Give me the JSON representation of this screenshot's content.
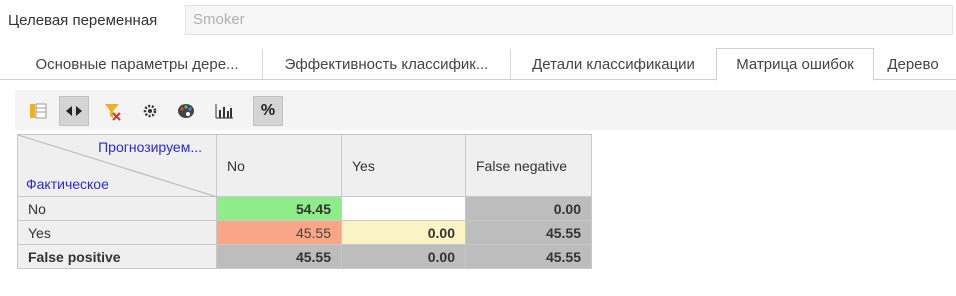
{
  "header": {
    "target_label": "Целевая переменная",
    "target_value": "Smoker"
  },
  "tabs": [
    {
      "label": "Основные параметры дере..."
    },
    {
      "label": "Эффективность классифик..."
    },
    {
      "label": "Детали классификации"
    },
    {
      "label": "Матрица ошибок",
      "active": true
    },
    {
      "label": "Дерево"
    }
  ],
  "toolbar": {
    "icons": [
      "columns-icon",
      "expand-horizontal-icon",
      "clear-filter-icon",
      "settings-gear-icon",
      "palette-icon",
      "bar-chart-icon",
      "percent-icon"
    ],
    "percent_label": "%"
  },
  "matrix": {
    "corner_predicted": "Прогнозируем...",
    "corner_actual": "Фактическое",
    "columns": [
      "No",
      "Yes",
      "False negative"
    ],
    "rows": [
      {
        "label": "No",
        "cells": [
          "54.45",
          "",
          "0.00"
        ]
      },
      {
        "label": "Yes",
        "cells": [
          "45.55",
          "0.00",
          "45.55"
        ]
      },
      {
        "label": "False positive",
        "cells": [
          "45.55",
          "0.00",
          "45.55"
        ]
      }
    ],
    "colors": {
      "correct": "#8eec8a",
      "error": "#f8a686",
      "low": "#faf3c4",
      "total": "#bdbdbd"
    }
  }
}
